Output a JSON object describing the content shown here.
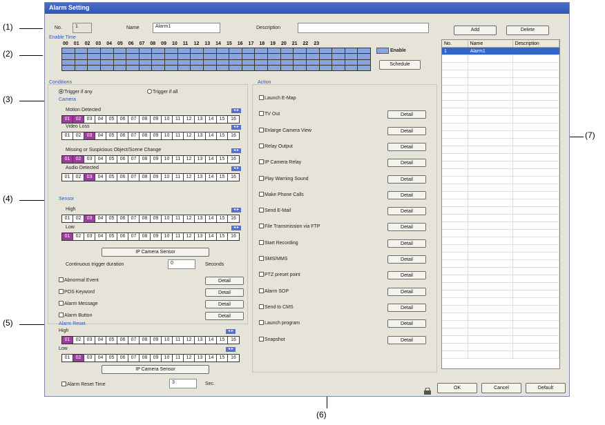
{
  "window": {
    "title": "Alarm Setting"
  },
  "callouts": [
    "(1)",
    "(2)",
    "(3)",
    "(4)",
    "(5)",
    "(6)",
    "(7)"
  ],
  "top": {
    "no_label": "No.",
    "no_value": "1",
    "name_label": "Name",
    "name_value": "Alarm1",
    "desc_label": "Description",
    "desc_value": ""
  },
  "list_buttons": {
    "add": "Add",
    "delete": "Delete"
  },
  "enable_time": {
    "title": "Enable Time",
    "hours": [
      "00",
      "01",
      "02",
      "03",
      "04",
      "05",
      "06",
      "07",
      "08",
      "09",
      "10",
      "11",
      "12",
      "13",
      "14",
      "15",
      "16",
      "17",
      "18",
      "19",
      "20",
      "21",
      "22",
      "23"
    ],
    "legend": "Enable",
    "schedule": "Schedule"
  },
  "conditions": {
    "title": "Conditions",
    "trigger_any": "Trigger if any",
    "trigger_all": "Trigger if all",
    "camera_title": "Camera",
    "motion": "Motion Detected",
    "video_loss": "Video Loss",
    "missing": "Missing or Suspicious Object/Scene Change",
    "audio": "Audio Detected",
    "sensor_title": "Sensor",
    "high": "High",
    "low": "Low",
    "ip_sensor": "IP Camera Sensor",
    "duration_label": "Continuous trigger duration",
    "duration_value": "0",
    "seconds": "Seconds",
    "arrows": "◂ ▸",
    "channels": [
      "01",
      "02",
      "03",
      "04",
      "05",
      "06",
      "07",
      "08",
      "09",
      "10",
      "11",
      "12",
      "13",
      "14",
      "15",
      "16"
    ],
    "options": [
      "Abnormal Event",
      "POS Keyword",
      "Alarm Message",
      "Alarm Button"
    ],
    "detail": "Detail"
  },
  "alarm_reset": {
    "title": "Alarm Reset",
    "high": "High",
    "low": "Low",
    "ip_sensor": "IP Camera Sensor",
    "reset_time_label": "Alarm Reset Time",
    "reset_time_value": "3",
    "sec": "Sec."
  },
  "action": {
    "title": "Action",
    "items": [
      "Launch E-Map",
      "TV Out",
      "Enlarge Camera View",
      "Relay Output",
      "IP Camera Relay",
      "Play Warning Sound",
      "Make Phone Calls",
      "Send E-Mail",
      "File Transmission via FTP",
      "Start Recording",
      "SMS/MMS",
      "PTZ preset point",
      "Alarm SOP",
      "Send to CMS",
      "Launch program",
      "Snapshot"
    ],
    "detail": "Detail"
  },
  "alarm_list": {
    "headers": [
      "No.",
      "Name",
      "Description"
    ],
    "rows": [
      [
        "1",
        "Alarm1",
        ""
      ]
    ]
  },
  "footer": {
    "ok": "OK",
    "cancel": "Cancel",
    "default": "Default"
  }
}
